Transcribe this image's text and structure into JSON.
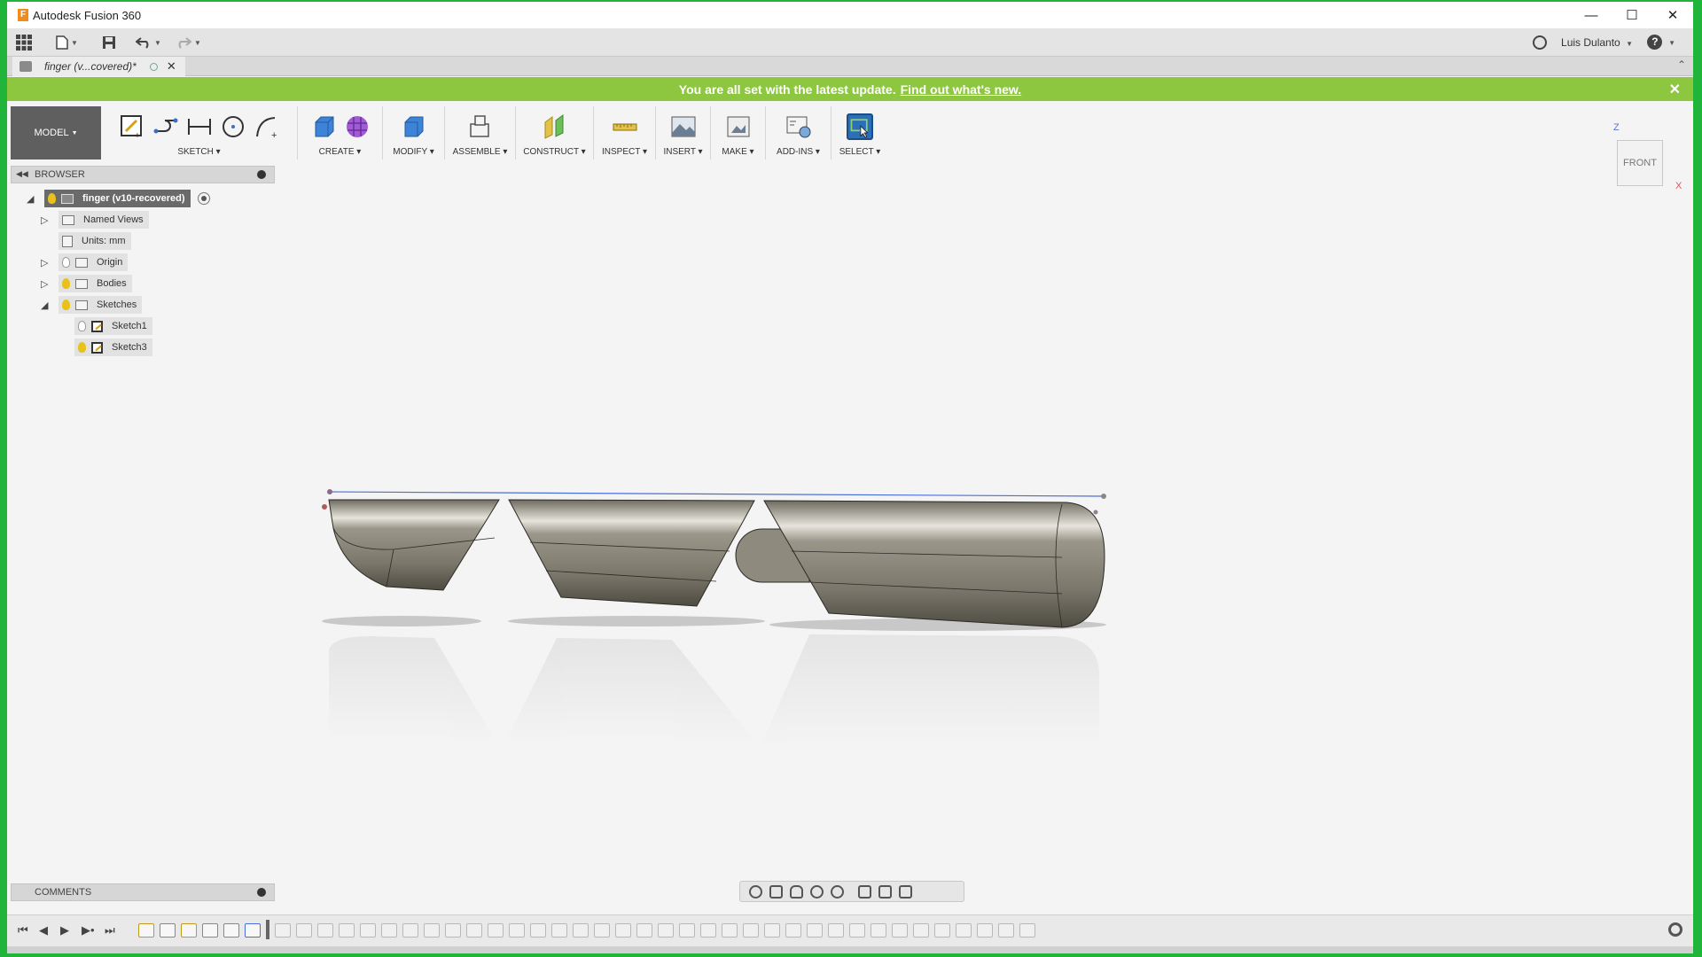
{
  "window": {
    "title": "Autodesk Fusion 360"
  },
  "qat": {
    "user_name": "Luis Dulanto",
    "help_label": "?"
  },
  "document_tab": {
    "title": "finger (v...covered)*"
  },
  "banner": {
    "text": "You are all set with the latest update.",
    "link": "Find out what's new."
  },
  "ribbon": {
    "workspace": "MODEL",
    "groups": [
      "SKETCH",
      "CREATE",
      "MODIFY",
      "ASSEMBLE",
      "CONSTRUCT",
      "INSPECT",
      "INSERT",
      "MAKE",
      "ADD-INS",
      "SELECT"
    ]
  },
  "browser": {
    "title": "BROWSER",
    "root": "finger (v10-recovered)",
    "items": [
      {
        "label": "Named Views"
      },
      {
        "label": "Units: mm"
      },
      {
        "label": "Origin"
      },
      {
        "label": "Bodies"
      },
      {
        "label": "Sketches"
      },
      {
        "label": "Sketch1"
      },
      {
        "label": "Sketch3"
      }
    ]
  },
  "viewcube": {
    "face": "FRONT",
    "axis_z": "Z",
    "axis_x": "X"
  },
  "comments": {
    "title": "COMMENTS"
  },
  "colors": {
    "banner": "#8dc63f",
    "workspace": "#5f5f5f",
    "select_icon": "#2a6fb8",
    "frame": "#1fb43a"
  }
}
